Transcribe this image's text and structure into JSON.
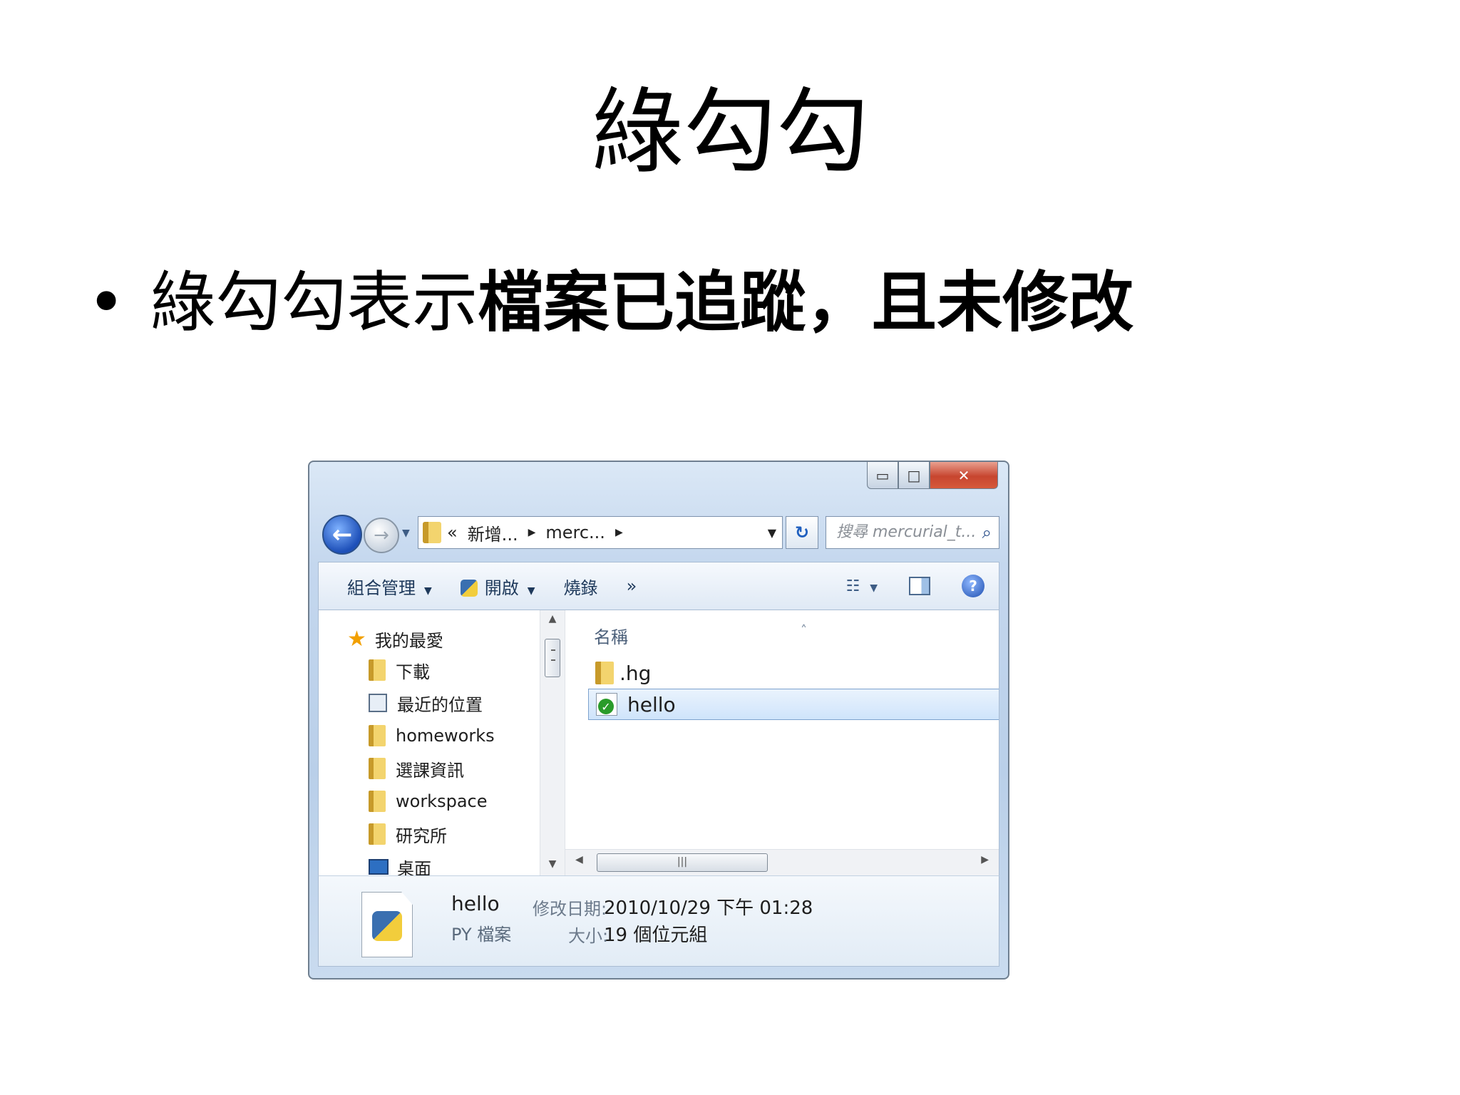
{
  "slide": {
    "title": "綠勾勾",
    "bullet_light": "綠勾勾表示",
    "bullet_bold": "檔案已追蹤，且未修改"
  },
  "explorer": {
    "caption": {
      "minimize": "▭",
      "maximize": "□",
      "close": "✕"
    },
    "nav": {
      "back_glyph": "←",
      "forward_glyph": "→",
      "breadcrumbs": [
        "«",
        "新增...",
        "merc..."
      ],
      "search_placeholder": "搜尋 mercurial_t...",
      "search_icon": "magnifier-icon"
    },
    "toolbar": {
      "organize": "組合管理",
      "open": "開啟",
      "burn": "燒錄",
      "more": "»"
    },
    "navpane": {
      "favorites": "我的最愛",
      "items": [
        "下載",
        "最近的位置",
        "homeworks",
        "選課資訊",
        "workspace",
        "研究所",
        "桌面"
      ]
    },
    "filepane": {
      "column_name": "名稱",
      "files": [
        {
          "name": ".hg",
          "type": "folder",
          "selected": false
        },
        {
          "name": "hello",
          "type": "py-tracked",
          "selected": true
        }
      ]
    },
    "details": {
      "name": "hello",
      "type": "PY 檔案",
      "modified_label": "修改日期:",
      "modified_value": "2010/10/29 下午 01:28",
      "size_label": "大小:",
      "size_value": "19 個位元組"
    },
    "colors": {
      "tracked_check": "#2a9b2a",
      "selection_border": "#7da2ce",
      "close_button": "#c7452f"
    }
  }
}
